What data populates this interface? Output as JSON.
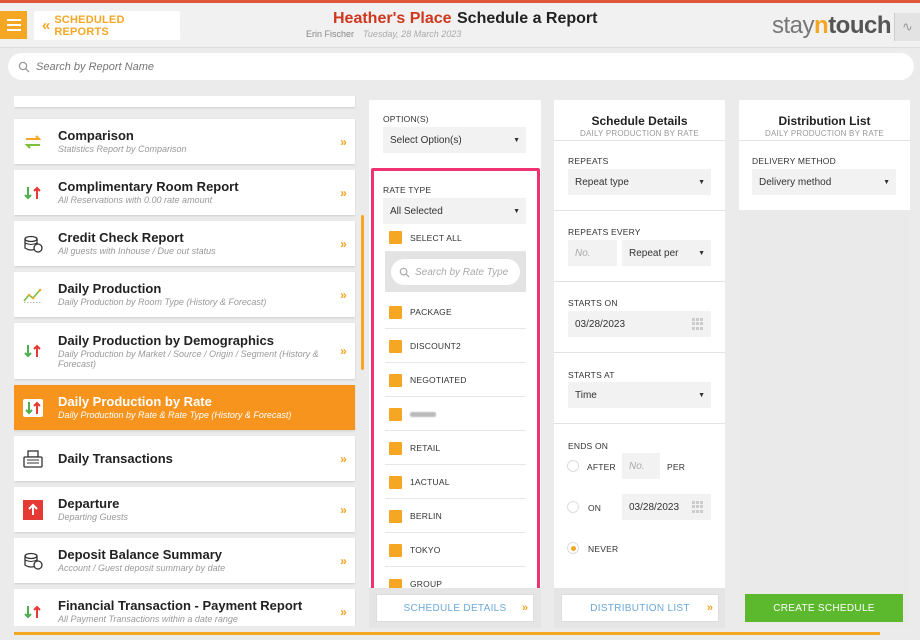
{
  "header": {
    "back_label": "SCHEDULED REPORTS",
    "hotel_name": "Heather's Place",
    "page_title": "Schedule a Report",
    "user_name": "Erin Fischer",
    "date": "Tuesday, 28 March 2023",
    "logo_a": "stay",
    "logo_b": "n",
    "logo_c": "touch"
  },
  "search": {
    "placeholder": "Search by Report Name"
  },
  "reports": [
    {
      "title": "Comparison",
      "subtitle": "Statistics Report by Comparison",
      "icon": "swap-arrows-icon",
      "active": false
    },
    {
      "title": "Complimentary Room Report",
      "subtitle": "All Reservations with 0.00 rate amount",
      "icon": "up-down-arrows-icon",
      "active": false
    },
    {
      "title": "Credit Check Report",
      "subtitle": "All guests with Inhouse / Due out status",
      "icon": "coins-icon",
      "active": false
    },
    {
      "title": "Daily Production",
      "subtitle": "Daily Production by Room Type (History & Forecast)",
      "icon": "trend-chart-icon",
      "active": false
    },
    {
      "title": "Daily Production by Demographics",
      "subtitle": "Daily Production by Market / Source / Origin / Segment (History & Forecast)",
      "icon": "up-down-arrows-icon",
      "active": false
    },
    {
      "title": "Daily Production by Rate",
      "subtitle": "Daily Production by Rate & Rate Type (History & Forecast)",
      "icon": "up-down-arrows-icon",
      "active": true
    },
    {
      "title": "Daily Transactions",
      "subtitle": "",
      "icon": "cash-register-icon",
      "active": false
    },
    {
      "title": "Departure",
      "subtitle": "Departing Guests",
      "icon": "departure-icon",
      "active": false
    },
    {
      "title": "Deposit Balance Summary",
      "subtitle": "Account / Guest deposit summary by date",
      "icon": "coins-icon",
      "active": false
    },
    {
      "title": "Financial Transaction - Payment Report",
      "subtitle": "All Payment Transactions within a date range",
      "icon": "up-down-arrows-icon",
      "active": false
    }
  ],
  "options": {
    "options_label": "OPTION(S)",
    "options_value": "Select Option(s)",
    "rate_type_label": "RATE TYPE",
    "rate_type_value": "All Selected",
    "select_all": "SELECT ALL",
    "rate_search_placeholder": "Search by Rate Type",
    "rate_types": [
      "PACKAGE",
      "DISCOUNT2",
      "NEGOTIATED",
      "",
      "RETAIL",
      "1ACTUAL",
      "BERLIN",
      "TOKYO",
      "GROUP"
    ],
    "next_button": "SCHEDULE DETAILS"
  },
  "schedule": {
    "title": "Schedule Details",
    "subtitle": "DAILY PRODUCTION BY RATE",
    "repeats_label": "REPEATS",
    "repeats_value": "Repeat type",
    "repeats_every_label": "REPEATS EVERY",
    "repeats_every_placeholder": "No.",
    "repeats_per_value": "Repeat per",
    "starts_on_label": "STARTS ON",
    "starts_on_value": "03/28/2023",
    "starts_at_label": "STARTS AT",
    "starts_at_value": "Time",
    "ends_on_label": "ENDS ON",
    "after_label": "AFTER",
    "after_placeholder": "No.",
    "per_label": "PER",
    "on_label": "ON",
    "on_value": "03/28/2023",
    "never_label": "NEVER",
    "ends_selected": "never",
    "next_button": "DISTRIBUTION LIST"
  },
  "distribution": {
    "title": "Distribution List",
    "subtitle": "DAILY PRODUCTION BY RATE",
    "delivery_label": "DELIVERY METHOD",
    "delivery_value": "Delivery method",
    "create_button": "CREATE SCHEDULE"
  },
  "colors": {
    "accent": "#f5a623",
    "brand_red": "#d0371d",
    "highlight": "#ee3370",
    "create": "#5cb82c"
  }
}
